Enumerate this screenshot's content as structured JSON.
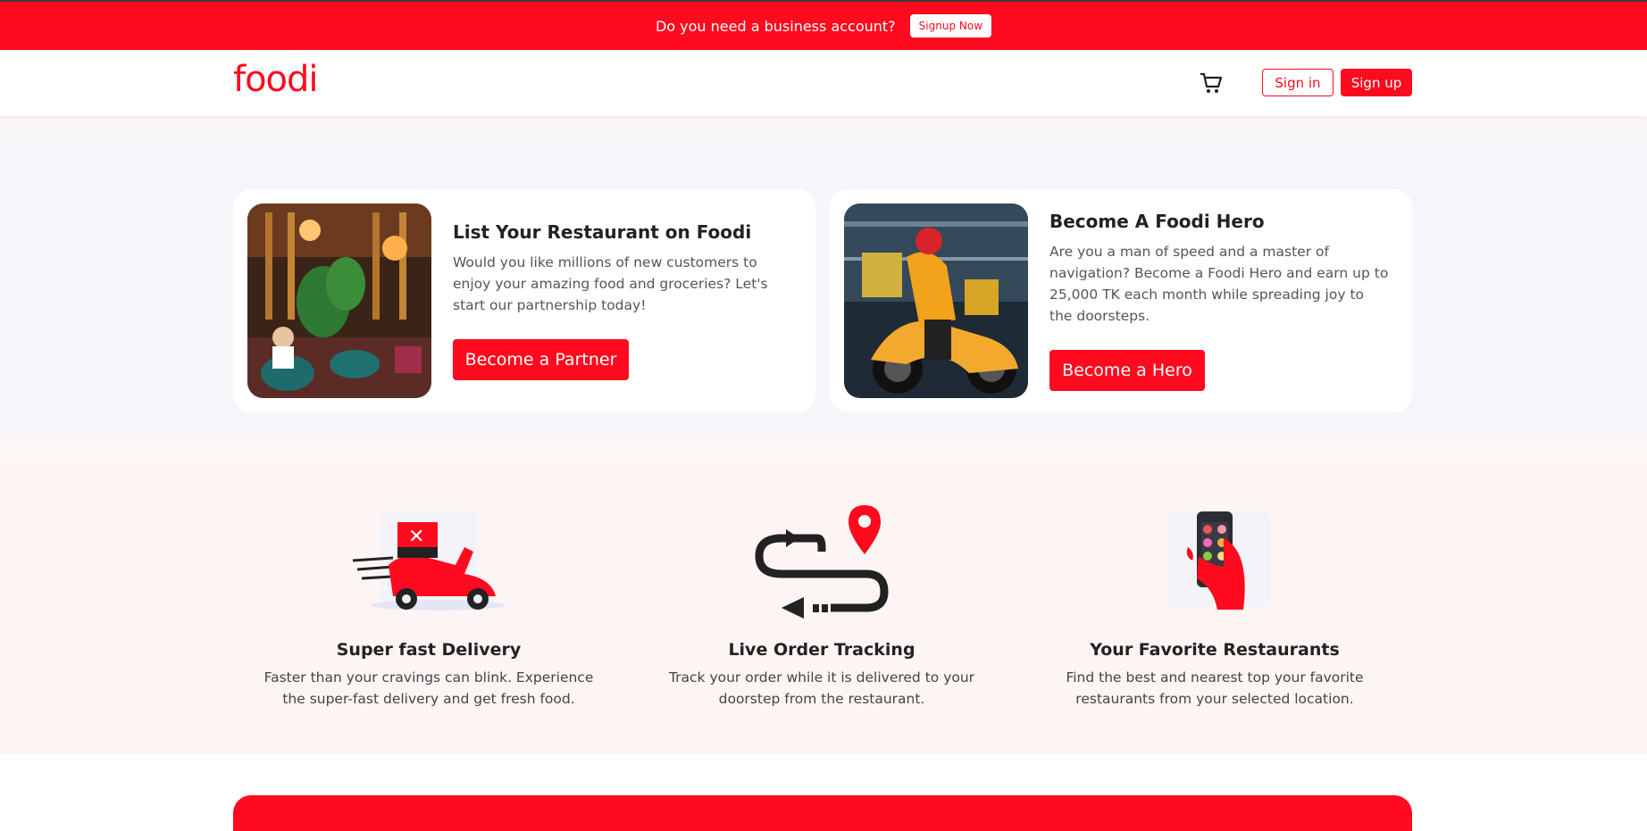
{
  "promo": {
    "text": "Do you need a business account?",
    "button": "Signup Now"
  },
  "header": {
    "logo": "foodi",
    "cart_icon": "cart-icon",
    "signin": "Sign in",
    "signup": "Sign up"
  },
  "partners": [
    {
      "title": "List Your Restaurant on Foodi",
      "description": "Would you like millions of new customers to enjoy your amazing food and groceries? Let's start our partnership today!",
      "button": "Become a Partner"
    },
    {
      "title": "Become A Foodi Hero",
      "description": "Are you a man of speed and a master of navigation? Become a Foodi Hero and earn up to 25,000 TK each month while spreading joy to the doorsteps.",
      "button": "Become a Hero"
    }
  ],
  "features": [
    {
      "title": "Super fast Delivery",
      "description": "Faster than your cravings can blink. Experience the super-fast delivery and get fresh food.",
      "icon": "scooter-icon"
    },
    {
      "title": "Live Order Tracking",
      "description": "Track your order while it is delivered to your doorstep from the restaurant.",
      "icon": "tracking-icon"
    },
    {
      "title": "Your Favorite Restaurants",
      "description": "Find the best and nearest top your favorite restaurants from your selected location.",
      "icon": "phone-menu-icon"
    }
  ],
  "colors": {
    "brand": "#ff0a1e",
    "section_bg": "#f5f6f9",
    "feature_bg": "#fdf5f4"
  }
}
